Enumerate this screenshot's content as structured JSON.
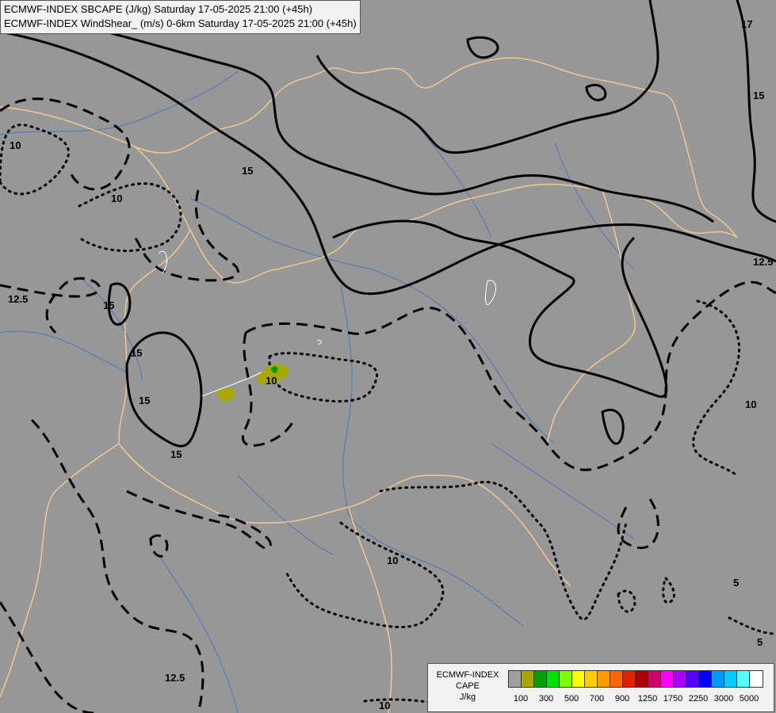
{
  "header": {
    "line1": "ECMWF-INDEX SBCAPE (J/kg) Saturday 17-05-2025 21:00 (+45h)",
    "line2": "ECMWF-INDEX WindShear_ (m/s) 0-6km Saturday 17-05-2025 21:00 (+45h)"
  },
  "legend": {
    "title1": "ECMWF-INDEX",
    "title2": "CAPE",
    "unit": "J/kg",
    "colors": [
      "#a0a0a0",
      "#a8a800",
      "#00a000",
      "#00e000",
      "#80ff00",
      "#ffff00",
      "#ffcc00",
      "#ff9900",
      "#ff6600",
      "#dd2200",
      "#aa0000",
      "#cc0066",
      "#ff00ff",
      "#aa00ff",
      "#5500ff",
      "#0000ff",
      "#0099ff",
      "#00ccff",
      "#55ffff",
      "#ffffff"
    ],
    "ticks": [
      "100",
      "300",
      "500",
      "700",
      "900",
      "1250",
      "1750",
      "2250",
      "3000",
      "5000"
    ]
  },
  "map": {
    "background": "#979797",
    "border_color": "#f0c890",
    "river_color": "#4a78b8",
    "contour_labels": [
      "10",
      "15",
      "15",
      "10",
      "12.5",
      "15",
      "15",
      "15",
      "10",
      "12.5",
      "10",
      "10",
      "12.5",
      "5",
      "5",
      "17",
      "15",
      "10"
    ]
  }
}
